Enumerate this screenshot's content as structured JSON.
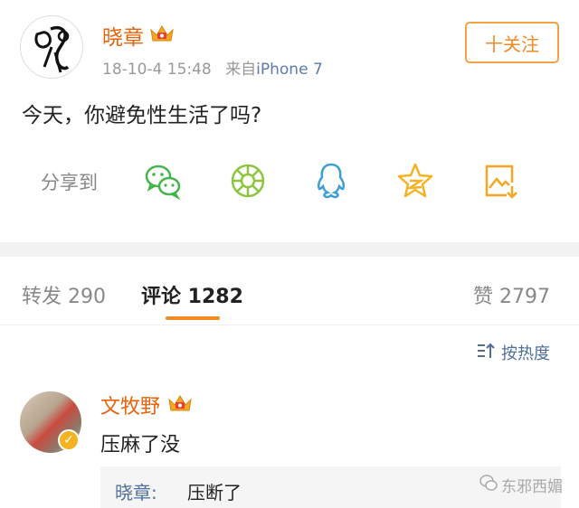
{
  "post": {
    "username": "晓章",
    "meta_date": "18-10-4 15:48",
    "meta_from": "来自",
    "meta_device": "iPhone 7",
    "follow_label": "十关注",
    "text": "今天，你避免性生活了吗?"
  },
  "share": {
    "label": "分享到",
    "targets": [
      "wechat-icon",
      "moments-icon",
      "qq-icon",
      "qzone-icon",
      "save-image-icon"
    ]
  },
  "tabs": {
    "repost": "转发 290",
    "comment": "评论 1282",
    "like": "赞 2797"
  },
  "sort": {
    "label": "按热度"
  },
  "comment": {
    "username": "文牧野",
    "text": "压麻了没",
    "reply_name": "晓章:",
    "reply_text": "压断了"
  },
  "watermark": {
    "text": "东邪西媚"
  },
  "colors": {
    "accent": "#f08a24",
    "username": "#e8630a",
    "link": "#4f6f99",
    "share_icon_wechat": "#43b649",
    "share_icon_moments": "#8cc63f",
    "share_icon_qq": "#3d9fd6",
    "share_icon_qzone": "#f5b324",
    "share_icon_save": "#f5a623"
  }
}
